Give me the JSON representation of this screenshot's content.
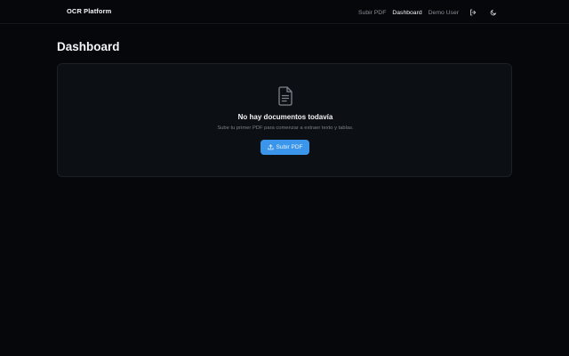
{
  "navbar": {
    "brand": "OCR Platform",
    "links": [
      {
        "label": "Subir PDF",
        "active": false
      },
      {
        "label": "Dashboard",
        "active": true
      },
      {
        "label": "Demo User",
        "active": false
      }
    ],
    "logout_icon": "logout-icon",
    "theme_icon": "moon-icon"
  },
  "page": {
    "title": "Dashboard"
  },
  "empty_state": {
    "icon": "document-icon",
    "title": "No hay documentos todavía",
    "subtitle": "Sube tu primer PDF para comenzar a extraer texto y tablas.",
    "button_label": "Subir PDF",
    "button_icon": "upload-icon"
  },
  "colors": {
    "background": "#05070a",
    "card": "#0c0f13",
    "accent": "#3b95ea",
    "muted_text": "#8b9098"
  }
}
